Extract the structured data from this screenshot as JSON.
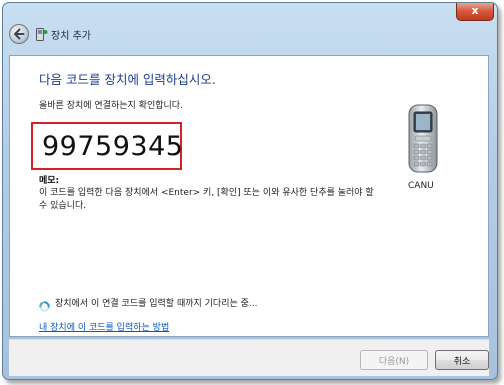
{
  "window": {
    "title": "장치 추가",
    "close_glyph": "x"
  },
  "main": {
    "heading": "다음 코드를 장치에 입력하십시오.",
    "subtext": "올바른 장치에 연결하는지 확인합니다.",
    "pairing_code": "99759345",
    "memo_label": "메모:",
    "memo_text": "이 코드를 입력한 다음 장치에서 <Enter> 키, [확인] 또는 이와 유사한 단추를 눌러야 할 수 있습니다.",
    "device_name": "CANU",
    "waiting_text": "장치에서 이 연결 코드를 입력할 때까지 기다리는 중...",
    "help_link": "내 장치에 이 코드를 입력하는 방법"
  },
  "footer": {
    "next_label": "다음(N)",
    "cancel_label": "취소"
  },
  "icons": {
    "back": "back-arrow-icon",
    "title": "bluetooth-device-icon",
    "device": "mobile-phone-icon",
    "spinner": "busy-spinner-icon"
  },
  "colors": {
    "heading": "#1e3f8e",
    "code_border": "#d8202a",
    "link": "#0b57c2",
    "titlebar": "#b3cde6"
  }
}
